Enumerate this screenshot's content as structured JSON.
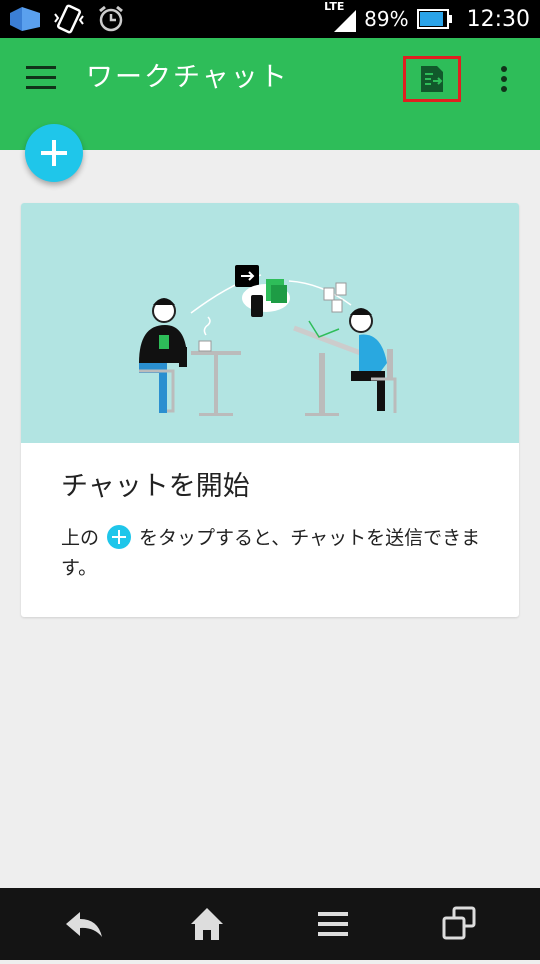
{
  "status_bar": {
    "network": "LTE",
    "battery": "89%",
    "time": "12:30",
    "icons": [
      "app-notification-icon",
      "vibrate-icon",
      "alarm-icon",
      "signal-icon",
      "battery-icon"
    ]
  },
  "app_bar": {
    "title": "ワークチャット",
    "icons": [
      "menu-icon",
      "document-share-icon",
      "more-vert-icon"
    ],
    "accent": "#2ebd59"
  },
  "fab": {
    "icon": "plus-icon",
    "color": "#1fc6ea"
  },
  "card": {
    "title": "チャットを開始",
    "body_before": "上の",
    "body_after": "をタップすると、チャットを送信できます。"
  },
  "nav_bar": {
    "icons": [
      "back-icon",
      "home-icon",
      "menu-icon",
      "recent-apps-icon"
    ]
  }
}
